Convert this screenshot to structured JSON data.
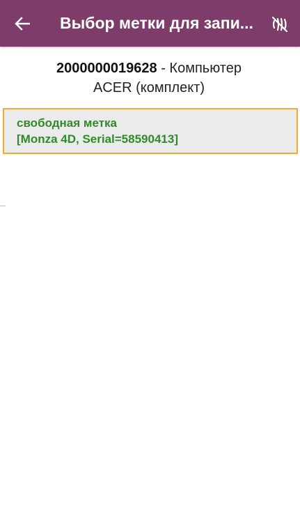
{
  "appbar": {
    "title": "Выбор метки для запи...",
    "back_icon": "arrow-back-icon",
    "nfc_icon": "nfc-off-icon",
    "color": "#7d3c6a"
  },
  "product": {
    "code": "2000000019628",
    "name_line1": " - Компьютер",
    "name_line2": "ACER (комплект)"
  },
  "tags": [
    {
      "status": "свободная метка",
      "info": "[Monza 4D, Serial=58590413]"
    }
  ],
  "colors": {
    "tag_text": "#2e8b28",
    "tag_border": "#f0a830"
  }
}
